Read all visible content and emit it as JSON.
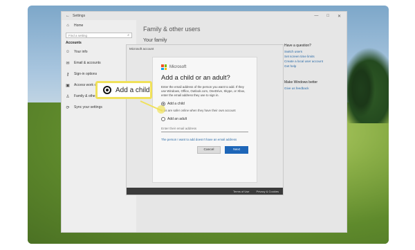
{
  "settings_window": {
    "title": "Settings",
    "controls": [
      "—",
      "□",
      "✕"
    ],
    "search_placeholder": "Find a setting",
    "sidebar": {
      "home_label": "Home",
      "section_label": "Accounts",
      "items": [
        {
          "label": "Your info",
          "icon": "person-icon"
        },
        {
          "label": "Email & accounts",
          "icon": "mail-icon"
        },
        {
          "label": "Sign-in options",
          "icon": "key-icon"
        },
        {
          "label": "Access work or school",
          "icon": "briefcase-icon"
        },
        {
          "label": "Family & other users",
          "icon": "family-icon"
        },
        {
          "label": "Sync your settings",
          "icon": "sync-icon"
        }
      ]
    },
    "main": {
      "title": "Family & other users",
      "subtitle": "Your family"
    },
    "right_column": {
      "question_heading": "Have a question?",
      "links": [
        "Switch users",
        "Set screen time limits",
        "Create a local user account",
        "Get help"
      ],
      "improve_heading": "Make Windows better",
      "feedback_link": "Give us feedback"
    }
  },
  "ms_account_window": {
    "title": "Microsoft account",
    "footer_links": [
      "Terms of Use",
      "Privacy & Cookies"
    ]
  },
  "dialog": {
    "brand": "Microsoft",
    "title": "Add a child or an adult?",
    "instructions": "Enter the email address of the person you want to add. If they use Windows, Office, Outlook.com, OneDrive, Skype, or Xbox, enter the email address they use to sign in.",
    "option_child": "Add a child",
    "child_note": "Kids are safer online when they have their own account",
    "option_adult": "Add an adult",
    "email_placeholder": "Enter their email address",
    "no_email_link": "The person I want to add doesn't have an email address",
    "cancel_label": "Cancel",
    "next_label": "Next"
  },
  "callout": {
    "label": "Add a child",
    "highlight_color": "#f0e15a"
  }
}
